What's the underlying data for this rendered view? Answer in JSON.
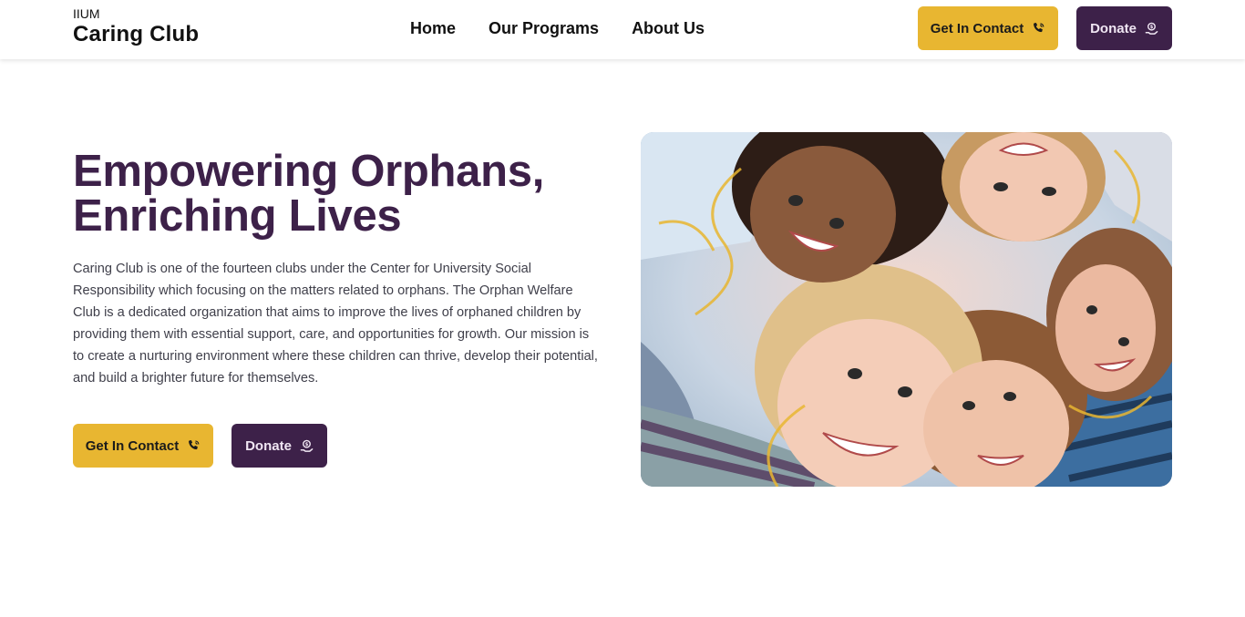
{
  "header": {
    "brand_small": "IIUM",
    "brand_big": "Caring Club",
    "nav": [
      "Home",
      "Our Programs",
      "About Us"
    ],
    "contact_label": "Get In Contact",
    "donate_label": "Donate"
  },
  "hero": {
    "title_line1": "Empowering Orphans,",
    "title_line2": "Enriching Lives",
    "description": "Caring Club is one of the fourteen clubs under the Center for University Social Responsibility which focusing on the matters related to orphans. The Orphan Welfare Club is a dedicated organization that aims to improve the lives of orphaned children by providing them with essential support, care, and opportunities for growth. Our mission is to create a nurturing environment where these children can thrive, develop their potential, and build a brighter future for themselves.",
    "contact_label": "Get In Contact",
    "donate_label": "Donate"
  },
  "colors": {
    "accent_yellow": "#e8b631",
    "accent_purple": "#3d2149"
  },
  "icons": {
    "contact": "phone-icon",
    "donate": "donate-hand-icon"
  }
}
